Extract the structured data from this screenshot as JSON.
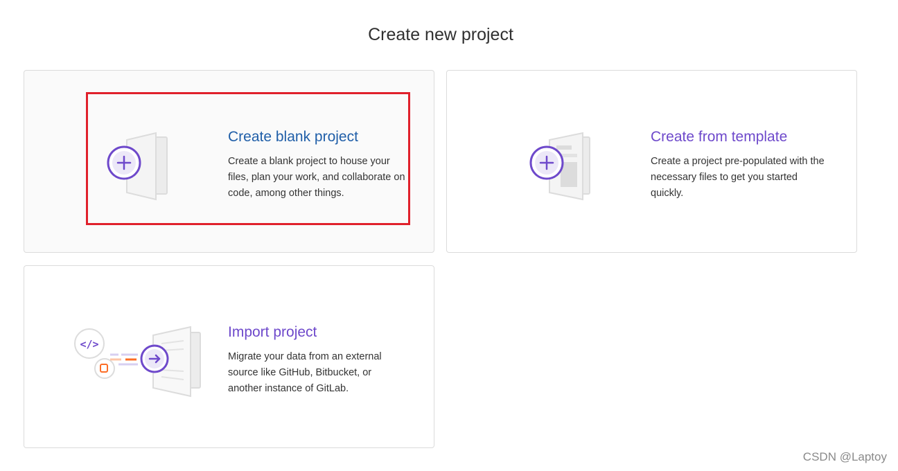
{
  "page": {
    "title": "Create new project"
  },
  "cards": {
    "blank": {
      "title": "Create blank project",
      "description": "Create a blank project to house your files, plan your work, and collaborate on code, among other things.",
      "icon": "plus-document-icon"
    },
    "template": {
      "title": "Create from template",
      "description": "Create a project pre-populated with the necessary files to get you started quickly.",
      "icon": "template-document-icon"
    },
    "import": {
      "title": "Import project",
      "description": "Migrate your data from an external source like GitHub, Bitbucket, or another instance of GitLab.",
      "icon": "import-arrow-icon"
    }
  },
  "watermark": "CSDN @Laptoy",
  "colors": {
    "title_link": "#6e49cb",
    "hovered_title_link": "#1f5ea8",
    "highlight": "#e0202b",
    "card_border": "#dbdbdb"
  }
}
